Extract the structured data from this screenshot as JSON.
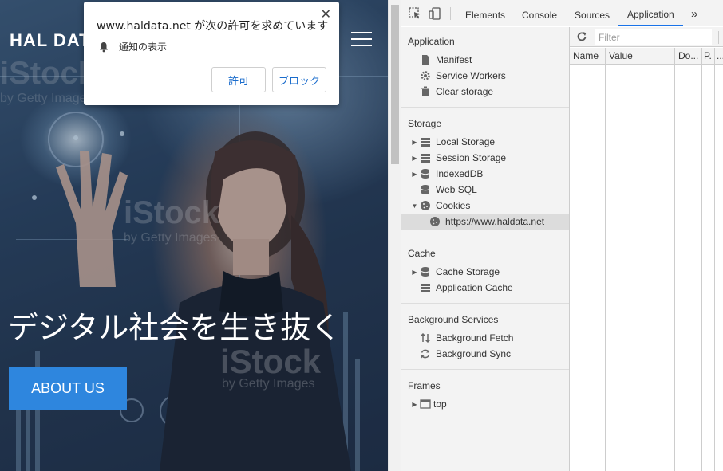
{
  "site": {
    "brand": "HAL DATA",
    "headline": "デジタル社会を生き抜く",
    "about_label": "ABOUT US",
    "watermarks": [
      "iStock",
      "by Getty Images",
      "iStock",
      "by Getty Images",
      "iStock",
      "by Getty Images"
    ]
  },
  "permission": {
    "title": "www.haldata.net が次の許可を求めています",
    "item_label": "通知の表示",
    "allow_label": "許可",
    "block_label": "ブロック",
    "close": "✕"
  },
  "devtools": {
    "tabs": [
      "Elements",
      "Console",
      "Sources",
      "Application"
    ],
    "active_tab": "Application",
    "more": "»",
    "sections": {
      "application": {
        "title": "Application",
        "items": [
          "Manifest",
          "Service Workers",
          "Clear storage"
        ]
      },
      "storage": {
        "title": "Storage",
        "items": [
          "Local Storage",
          "Session Storage",
          "IndexedDB",
          "Web SQL",
          "Cookies",
          "https://www.haldata.net"
        ]
      },
      "cache": {
        "title": "Cache",
        "items": [
          "Cache Storage",
          "Application Cache"
        ]
      },
      "background": {
        "title": "Background Services",
        "items": [
          "Background Fetch",
          "Background Sync"
        ]
      },
      "frames": {
        "title": "Frames",
        "items": [
          "top"
        ]
      }
    },
    "filter_placeholder": "Filter",
    "columns": [
      "Name",
      "Value",
      "Do...",
      "P.",
      "..."
    ]
  }
}
